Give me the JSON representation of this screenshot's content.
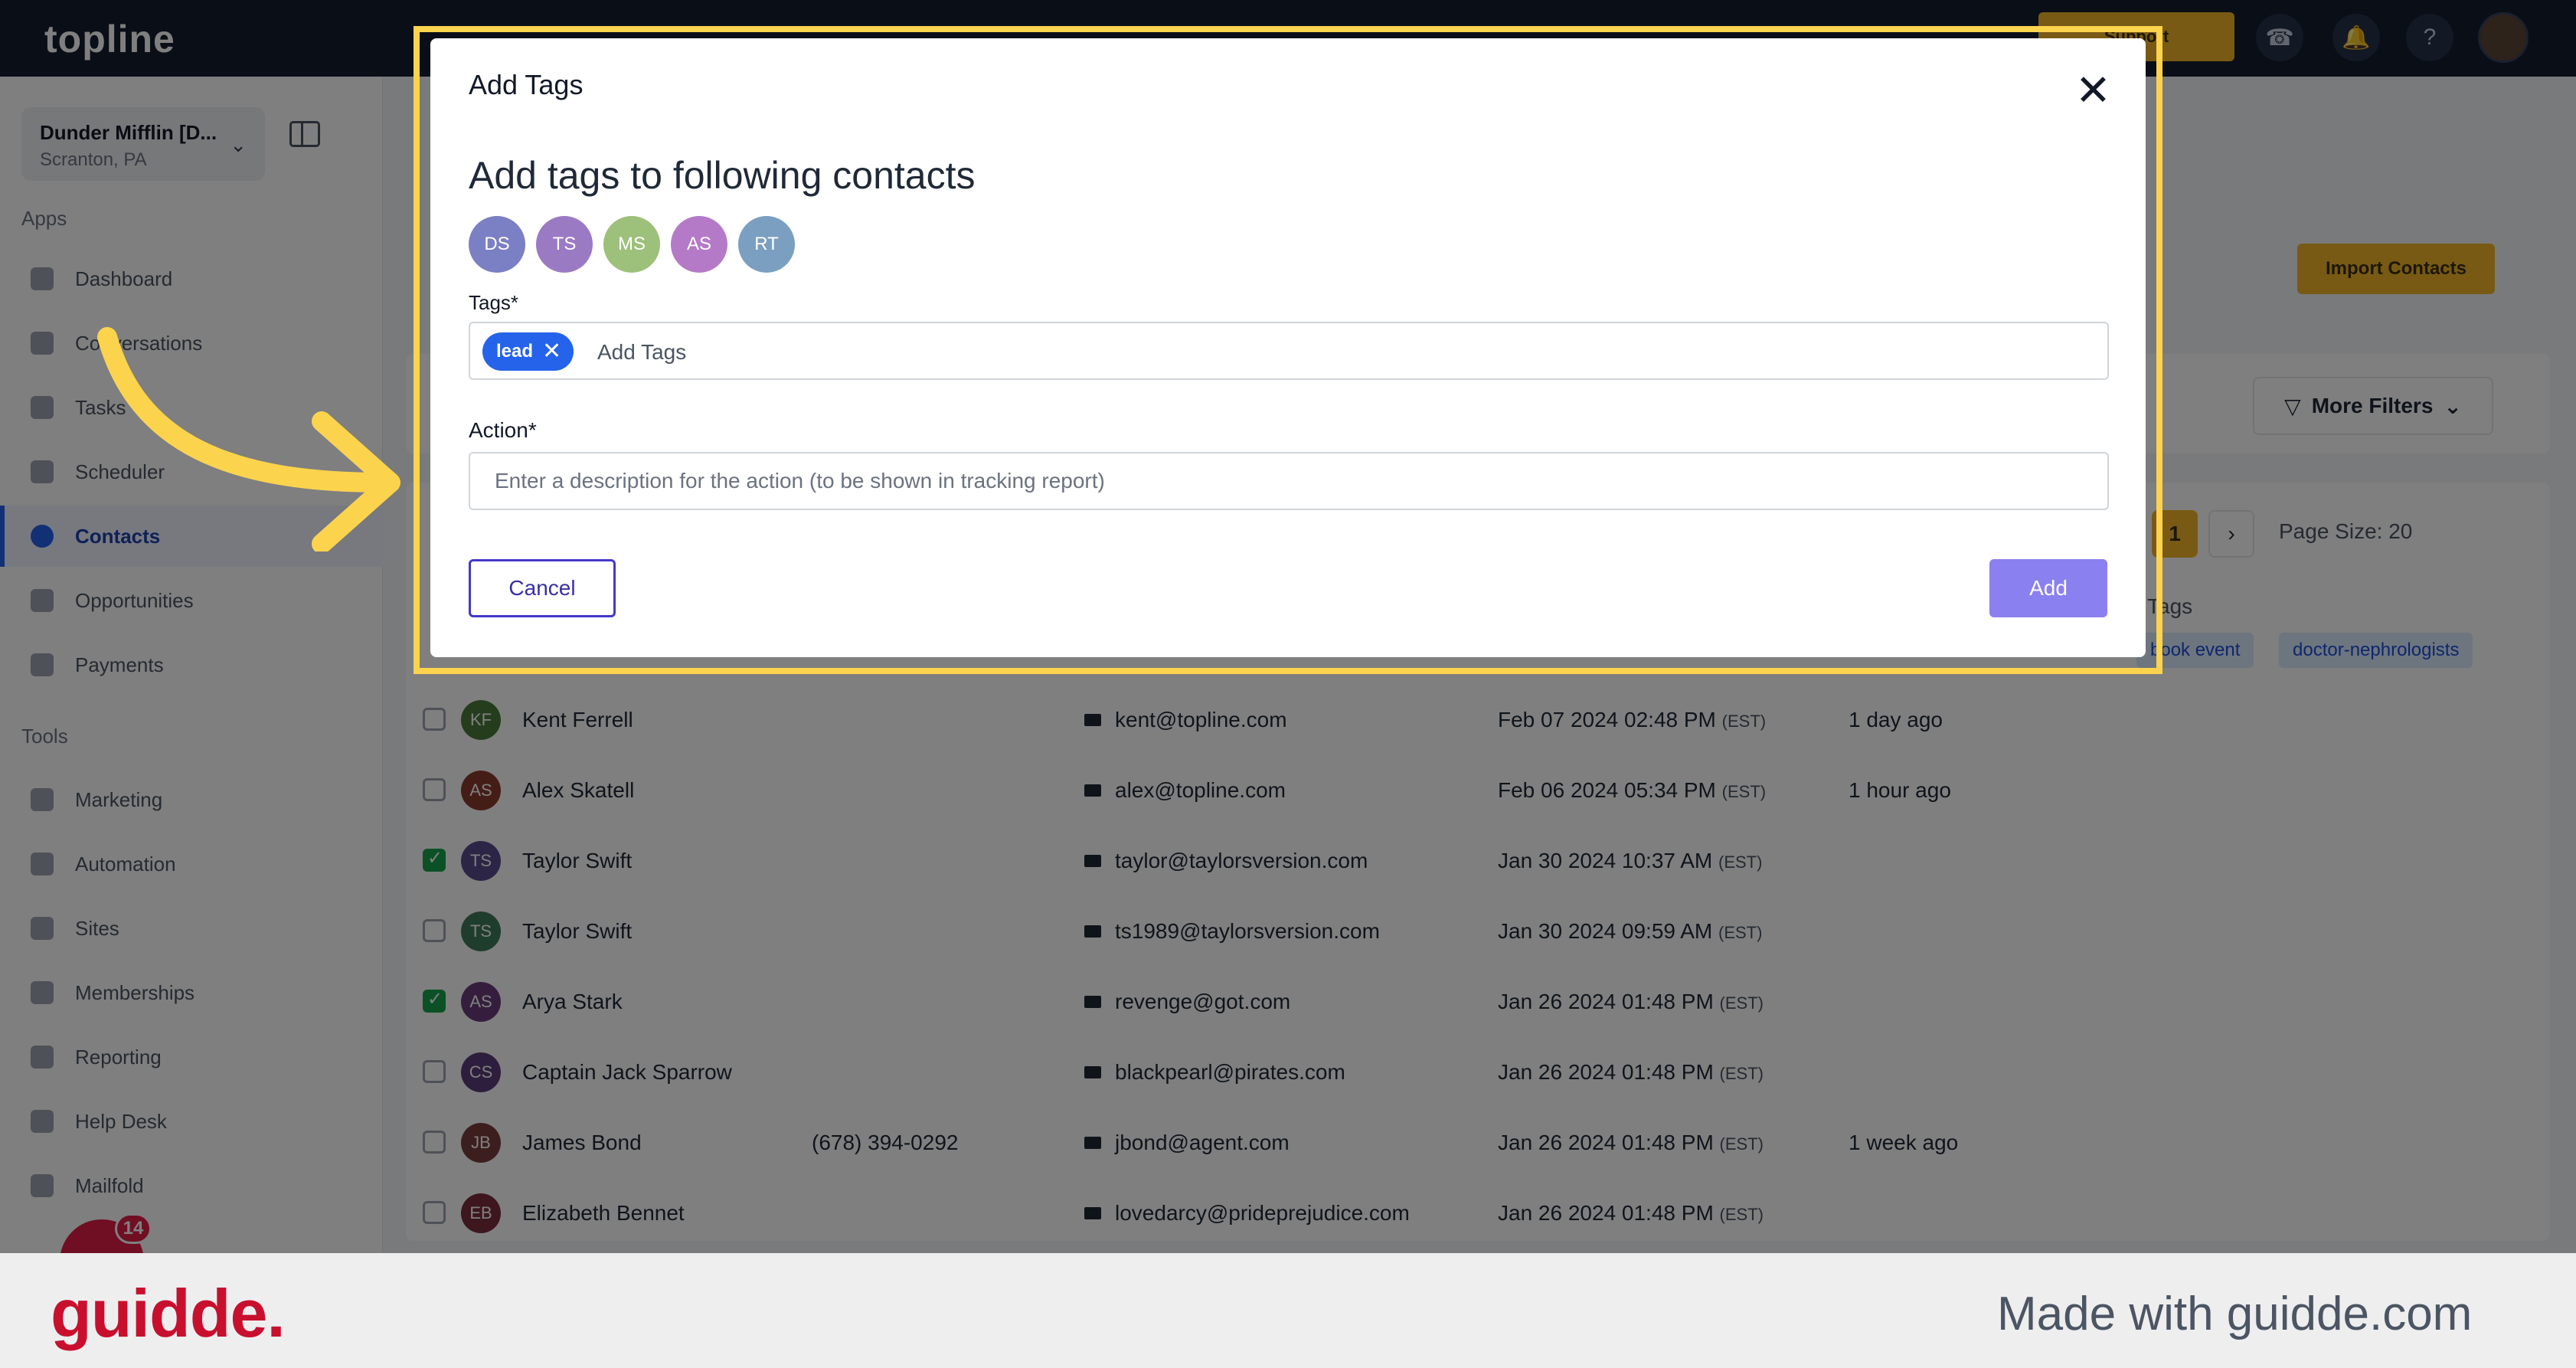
{
  "app": {
    "logo": "topline",
    "support_label": "Support"
  },
  "sidebar": {
    "company_name": "Dunder Mifflin [D...",
    "company_location": "Scranton, PA",
    "apps_section": "Apps",
    "tools_section": "Tools",
    "items": [
      {
        "label": "Dashboard",
        "icon": "dashboard-icon"
      },
      {
        "label": "Conversations",
        "icon": "chat-icon"
      },
      {
        "label": "Tasks",
        "icon": "tasks-icon"
      },
      {
        "label": "Scheduler",
        "icon": "calendar-icon"
      },
      {
        "label": "Contacts",
        "icon": "user-icon",
        "active": true
      },
      {
        "label": "Opportunities",
        "icon": "opportunities-icon"
      },
      {
        "label": "Payments",
        "icon": "payments-icon"
      }
    ],
    "tools": [
      {
        "label": "Marketing",
        "icon": "megaphone-icon"
      },
      {
        "label": "Automation",
        "icon": "automation-icon"
      },
      {
        "label": "Sites",
        "icon": "sites-icon"
      },
      {
        "label": "Memberships",
        "icon": "memberships-icon"
      },
      {
        "label": "Reporting",
        "icon": "reporting-icon"
      },
      {
        "label": "Help Desk",
        "icon": "help-icon"
      },
      {
        "label": "Mailfold",
        "icon": "mail-icon"
      }
    ],
    "chat_badge": "14"
  },
  "main": {
    "import_label": "Import Contacts",
    "more_filters_label": "More Filters",
    "current_page": "1",
    "page_size_label": "Page Size: 20",
    "tags_header": "Tags",
    "visible_tags": [
      "book event",
      "doctor-nephrologists"
    ],
    "rows": [
      {
        "initials": "KF",
        "name": "Kent Ferrell",
        "phone": "",
        "email": "kent@topline.com",
        "date": "Feb 07 2024 02:48 PM",
        "tz": "(EST)",
        "activity": "1 day ago",
        "checked": false,
        "color": "#4b7a3a"
      },
      {
        "initials": "AS",
        "name": "Alex Skatell",
        "phone": "",
        "email": "alex@topline.com",
        "date": "Feb 06 2024 05:34 PM",
        "tz": "(EST)",
        "activity": "1 hour ago",
        "checked": false,
        "color": "#8a3b2e"
      },
      {
        "initials": "TS",
        "name": "Taylor Swift",
        "phone": "",
        "email": "taylor@taylorsversion.com",
        "date": "Jan 30 2024 10:37 AM",
        "tz": "(EST)",
        "activity": "",
        "checked": true,
        "color": "#5b4a8c"
      },
      {
        "initials": "TS",
        "name": "Taylor Swift",
        "phone": "",
        "email": "ts1989@taylorsversion.com",
        "date": "Jan 30 2024 09:59 AM",
        "tz": "(EST)",
        "activity": "",
        "checked": false,
        "color": "#3f7a5a"
      },
      {
        "initials": "AS",
        "name": "Arya Stark",
        "phone": "",
        "email": "revenge@got.com",
        "date": "Jan 26 2024 01:48 PM",
        "tz": "(EST)",
        "activity": "",
        "checked": true,
        "color": "#6a3d7a"
      },
      {
        "initials": "CS",
        "name": "Captain Jack Sparrow",
        "phone": "",
        "email": "blackpearl@pirates.com",
        "date": "Jan 26 2024 01:48 PM",
        "tz": "(EST)",
        "activity": "",
        "checked": false,
        "color": "#5a3d7a"
      },
      {
        "initials": "JB",
        "name": "James Bond",
        "phone": "(678) 394-0292",
        "email": "jbond@agent.com",
        "date": "Jan 26 2024 01:48 PM",
        "tz": "(EST)",
        "activity": "1 week ago",
        "checked": false,
        "color": "#7a3d3d"
      },
      {
        "initials": "EB",
        "name": "Elizabeth Bennet",
        "phone": "",
        "email": "lovedarcy@prideprejudice.com",
        "date": "Jan 26 2024 01:48 PM",
        "tz": "(EST)",
        "activity": "",
        "checked": false,
        "color": "#7a2d3d"
      }
    ]
  },
  "modal": {
    "title": "Add Tags",
    "heading": "Add tags to following contacts",
    "contacts": [
      {
        "initials": "DS",
        "color": "#7b7fc4"
      },
      {
        "initials": "TS",
        "color": "#9b7ac4"
      },
      {
        "initials": "MS",
        "color": "#9dc07a"
      },
      {
        "initials": "AS",
        "color": "#b47ac8"
      },
      {
        "initials": "RT",
        "color": "#7a9fc0"
      }
    ],
    "tags_label": "Tags*",
    "selected_tag": "lead",
    "tags_placeholder": "Add Tags",
    "action_label": "Action*",
    "action_placeholder": "Enter a description for the action (to be shown in tracking report)",
    "cancel_label": "Cancel",
    "add_label": "Add"
  },
  "footer": {
    "logo": "guidde.",
    "made_with": "Made with guidde.com"
  },
  "colors": {
    "highlight": "#fcd34d",
    "primary": "#2563eb",
    "add_button": "#8b80f0"
  }
}
